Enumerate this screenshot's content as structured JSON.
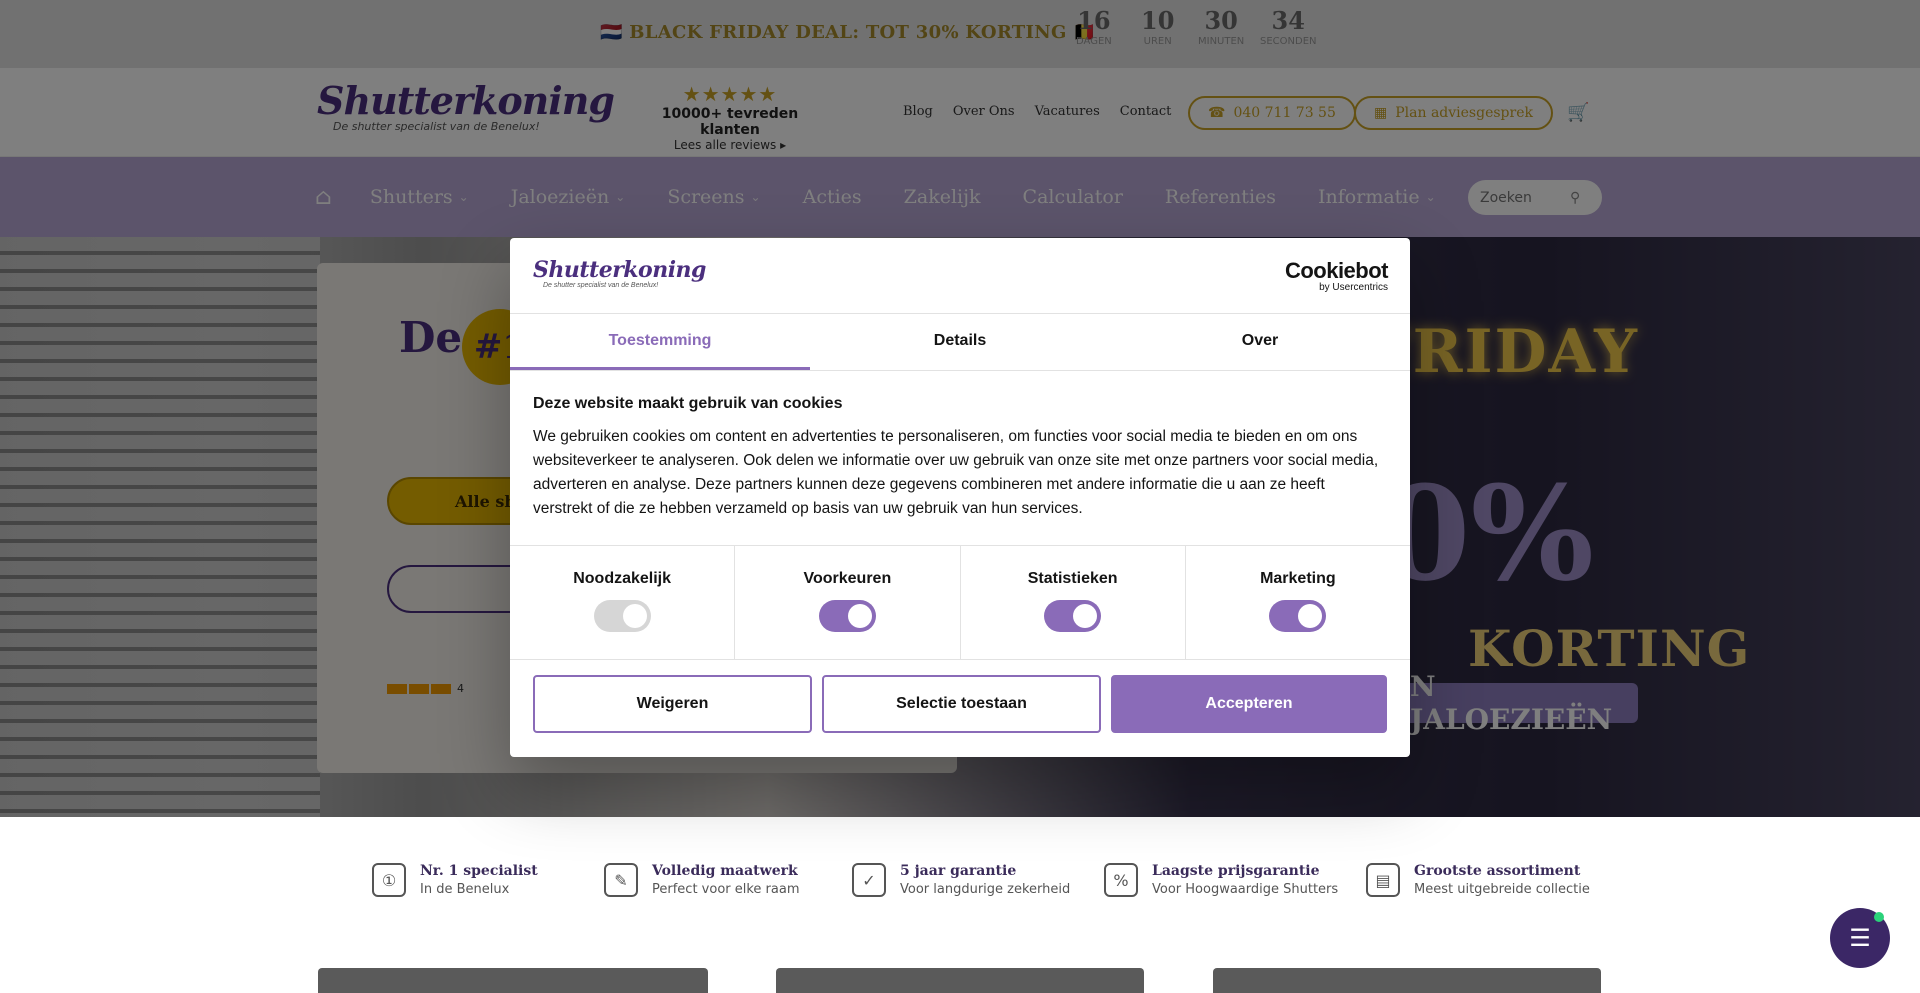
{
  "promo": {
    "text": "🇳🇱 BLACK FRIDAY DEAL: TOT 30% KORTING 🇧🇪",
    "countdown": [
      {
        "value": "16",
        "label": "Dagen"
      },
      {
        "value": "10",
        "label": "Uren"
      },
      {
        "value": "30",
        "label": "Minuten"
      },
      {
        "value": "34",
        "label": "Seconden"
      }
    ]
  },
  "header": {
    "logo_word": "Shutterkoning",
    "logo_tag": "De shutter specialist van de Benelux!",
    "stars": "★★★★★",
    "reviews_count": "10000+ tevreden klanten",
    "reviews_link": "Lees alle reviews ▸",
    "links": [
      "Blog",
      "Over Ons",
      "Vacatures",
      "Contact"
    ],
    "phone": "040 711 73 55",
    "appointment": "Plan adviesgesprek",
    "phone_icon": "☎",
    "calendar_icon": "▦",
    "cart_icon": "🛒"
  },
  "nav": {
    "home_icon": "⌂",
    "items": [
      {
        "label": "Shutters",
        "dropdown": "⌄"
      },
      {
        "label": "Jaloezieën",
        "dropdown": "⌄"
      },
      {
        "label": "Screens",
        "dropdown": "⌄"
      },
      {
        "label": "Acties",
        "dropdown": ""
      },
      {
        "label": "Zakelijk",
        "dropdown": ""
      },
      {
        "label": "Calculator",
        "dropdown": ""
      },
      {
        "label": "Referenties",
        "dropdown": ""
      },
      {
        "label": "Informatie",
        "dropdown": "⌄"
      }
    ],
    "search_placeholder": "Zoeken",
    "search_icon": "⚲"
  },
  "hero": {
    "title": "De",
    "badge": "#1",
    "button1": "Alle sh",
    "kiyoh_score": "4",
    "bf_friday": "FRIDAY",
    "bf_pct": "0%",
    "bf_korting": "KORTING",
    "bf_pill": "N JALOEZIEËN"
  },
  "usps": [
    {
      "icon": "①",
      "title": "Nr. 1 specialist",
      "sub": "In de Benelux"
    },
    {
      "icon": "✎",
      "title": "Volledig maatwerk",
      "sub": "Perfect voor elke raam"
    },
    {
      "icon": "✓",
      "title": "5 jaar garantie",
      "sub": "Voor langdurige zekerheid"
    },
    {
      "icon": "%",
      "title": "Laagste prijsgarantie",
      "sub": "Voor Hoogwaardige Shutters"
    },
    {
      "icon": "▤",
      "title": "Grootste assortiment",
      "sub": "Meest uitgebreide collectie"
    }
  ],
  "chat_icon": "☰",
  "cookie": {
    "logo_word": "Shutterkoning",
    "logo_tag": "De shutter specialist van de Benelux!",
    "brand_main": "Cookiebot",
    "brand_sub": "by Usercentrics",
    "tabs": [
      "Toestemming",
      "Details",
      "Over"
    ],
    "heading": "Deze website maakt gebruik van cookies",
    "body": "We gebruiken cookies om content en advertenties te personaliseren, om functies voor social media te bieden en om ons websiteverkeer te analyseren. Ook delen we informatie over uw gebruik van onze site met onze partners voor social media, adverteren en analyse. Deze partners kunnen deze gegevens combineren met andere informatie die u aan ze heeft verstrekt of die ze hebben verzameld op basis van uw gebruik van hun services.",
    "toggles": [
      {
        "label": "Noodzakelijk",
        "on": false
      },
      {
        "label": "Voorkeuren",
        "on": true
      },
      {
        "label": "Statistieken",
        "on": true
      },
      {
        "label": "Marketing",
        "on": true
      }
    ],
    "buttons": {
      "deny": "Weigeren",
      "selection": "Selectie toestaan",
      "accept": "Accepteren"
    },
    "accent": "#8a6bb8"
  }
}
